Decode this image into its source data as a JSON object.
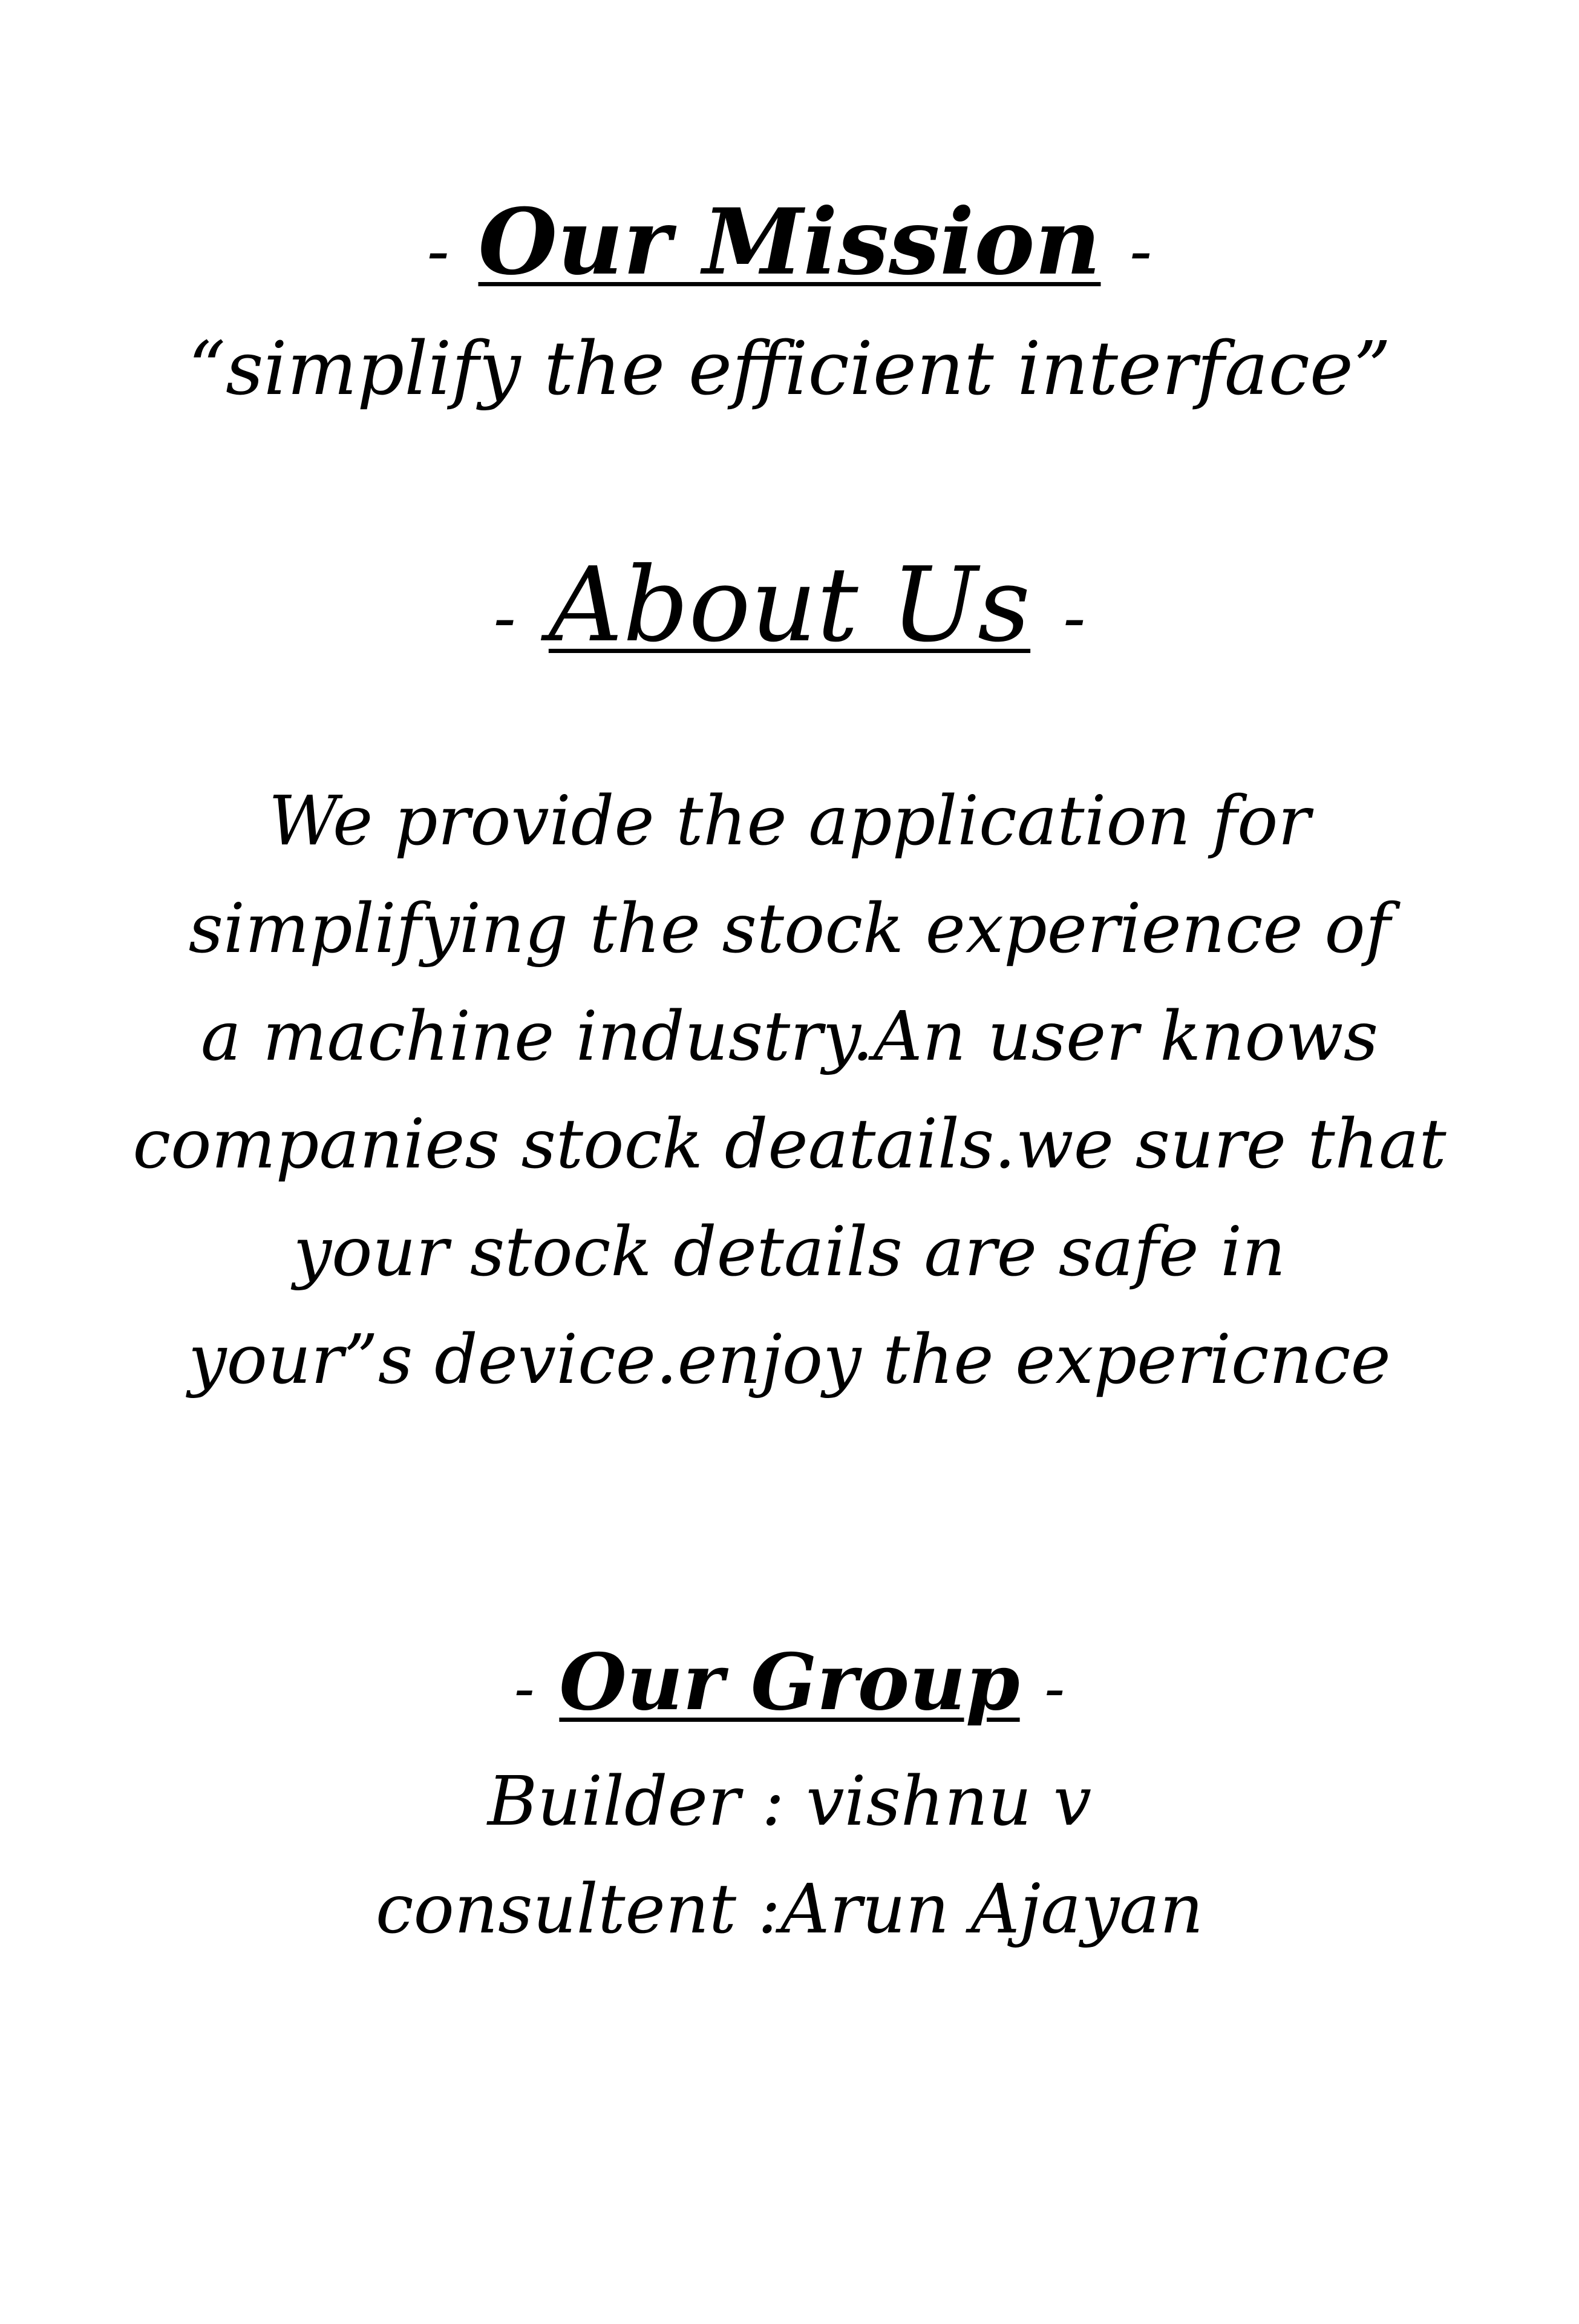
{
  "mission": {
    "dash_left": "-",
    "heading": "Our Mission",
    "dash_right": "-",
    "quote": "“simplify the efficient interface”"
  },
  "about": {
    "dash_left": "-",
    "heading": "About Us",
    "dash_right": "-",
    "body_lines": [
      "We provide the application for",
      "simplifying the stock experience of",
      "a machine industry.An user knows",
      "companies stock deatails.we sure that",
      "your stock details are safe in",
      "your”s device.enjoy the expericnce"
    ]
  },
  "group": {
    "dash_left": "-",
    "heading": "Our Group",
    "dash_right": "-",
    "members": [
      "Builder : vishnu v",
      "consultent :Arun Ajayan"
    ]
  }
}
